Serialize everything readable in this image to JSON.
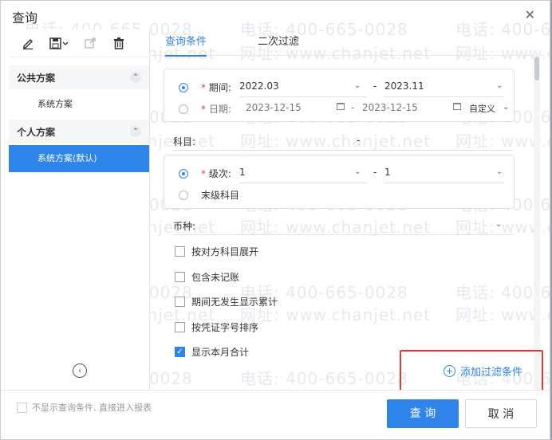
{
  "dialog": {
    "title": "查询"
  },
  "watermark": {
    "phone": "电话: 400-665-0028",
    "site": "网址: www.chanjet.net"
  },
  "left": {
    "groups": [
      {
        "label": "公共方案",
        "items": [
          "系统方案"
        ]
      },
      {
        "label": "个人方案",
        "items": [
          "系统方案(默认)"
        ]
      }
    ]
  },
  "tabs": [
    "查询条件",
    "二次过滤"
  ],
  "form": {
    "period_label": "期间:",
    "period_from": "2022.03",
    "period_to": "2023.11",
    "date_label": "日期:",
    "date_from": "2023-12-15",
    "date_to": "2023-12-15",
    "date_mode": "自定义",
    "subject_label": "科目:",
    "subject_sep": "-",
    "level_label": "级次:",
    "level_from": "1",
    "level_to": "1",
    "last_level": "末级科目",
    "currency_label": "币种:",
    "dash": "-",
    "options": [
      {
        "label": "按对方科目展开",
        "checked": false
      },
      {
        "label": "包含未记账",
        "checked": false
      },
      {
        "label": "期间无发生显示累计",
        "checked": false
      },
      {
        "label": "按凭证字号排序",
        "checked": false
      },
      {
        "label": "显示本月合计",
        "checked": true
      }
    ]
  },
  "add_filter": "添加过滤条件",
  "footer": {
    "skip_label": "不显示查询条件, 直接进入报表",
    "query": "查 询",
    "cancel": "取 消"
  },
  "colors": {
    "accent": "#2f84ea",
    "highlight": "#e53935"
  }
}
